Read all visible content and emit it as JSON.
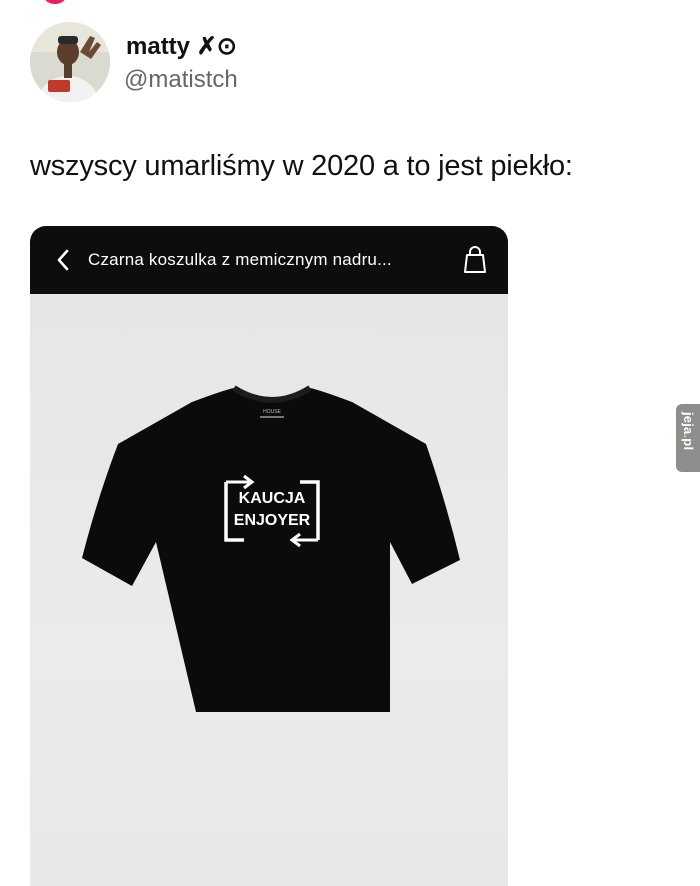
{
  "post": {
    "author_name": "matty ✗⊙",
    "author_handle": "@matistch",
    "text": "wszyscy umarliśmy w 2020 a to jest piekło:"
  },
  "embedded_screenshot": {
    "header_title": "Czarna koszulka z memicznym nadru...",
    "back_icon": "chevron-left-icon",
    "bag_icon": "shopping-bag-icon",
    "product_print_line1": "KAUCJA",
    "product_print_line2": "ENJOYER",
    "tag_text": "HOUSE"
  },
  "watermark": {
    "brand": "jeja",
    "dot": ".",
    "tld": "pl"
  },
  "colors": {
    "header_bg": "#0d0d0d",
    "product_bg": "#e8e8e9",
    "handle": "#666666",
    "watermark_accent": "#ffd24a"
  }
}
